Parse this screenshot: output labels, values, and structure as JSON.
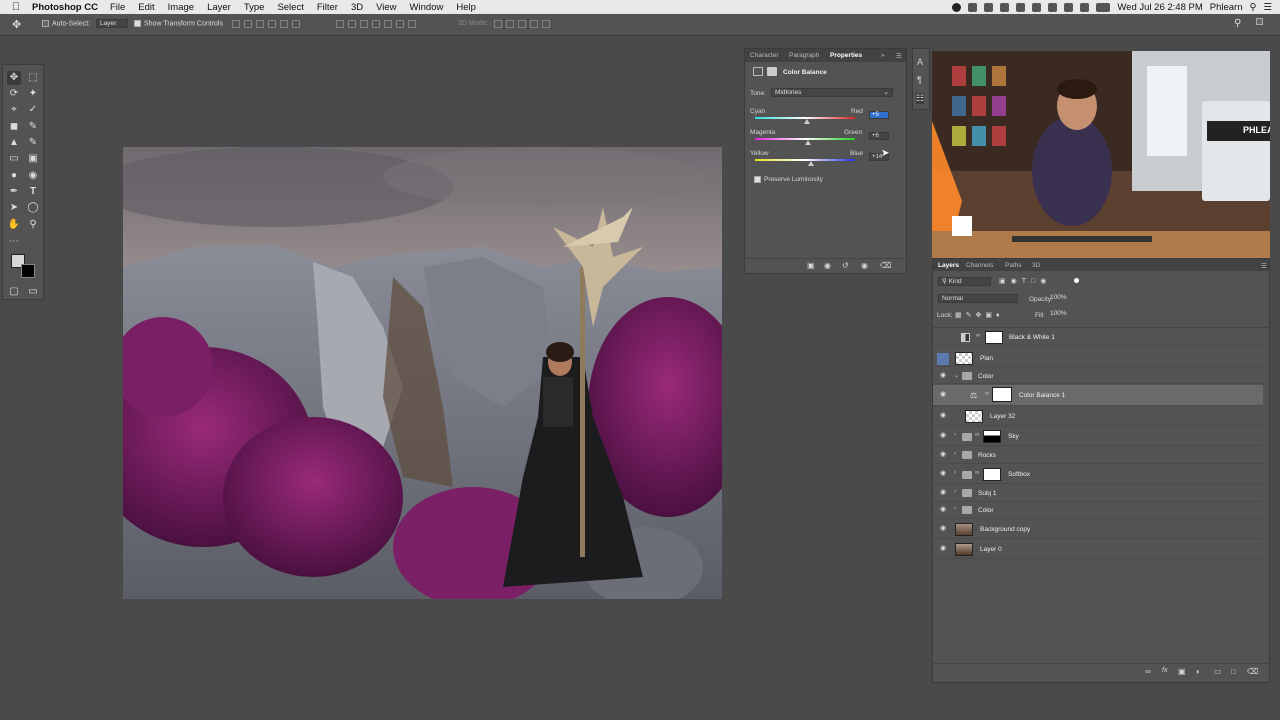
{
  "menubar": {
    "apple": "",
    "app_name": "Photoshop CC",
    "menus": [
      "File",
      "Edit",
      "Image",
      "Layer",
      "Type",
      "Select",
      "Filter",
      "3D",
      "View",
      "Window",
      "Help"
    ],
    "clock": "Wed Jul 26  2:48 PM",
    "user": "Phlearn"
  },
  "options_bar": {
    "auto_select_label": "Auto-Select:",
    "auto_select_value": "Layer",
    "show_transform_label": "Show Transform Controls",
    "mode_3d_label": "3D Mode:"
  },
  "properties_panel": {
    "tabs": [
      "Character",
      "Paragraph",
      "Properties"
    ],
    "active_tab": "Properties",
    "title": "Color Balance",
    "tone_label": "Tone:",
    "tone_value": "Midtones",
    "sliders": [
      {
        "left": "Cyan",
        "right": "Red",
        "value": "+5",
        "position": 0.52
      },
      {
        "left": "Magenta",
        "right": "Green",
        "value": "+6",
        "position": 0.53
      },
      {
        "left": "Yellow",
        "right": "Blue",
        "value": "+14",
        "position": 0.56
      }
    ],
    "preserve_label": "Preserve Luminosity",
    "preserve_checked": true
  },
  "layers_panel": {
    "tabs": [
      "Layers",
      "Channels",
      "Paths",
      "3D"
    ],
    "active_tab": "Layers",
    "filter_label": "Kind",
    "blend_mode": "Normal",
    "opacity_label": "Opacity:",
    "opacity_value": "100%",
    "lock_label": "Lock:",
    "fill_label": "Fill:",
    "fill_value": "100%",
    "layers": [
      {
        "name": "Black & White 1",
        "visible": false,
        "selected": false
      },
      {
        "name": "Plan",
        "visible": false,
        "selected": false
      },
      {
        "name": "Color",
        "visible": true,
        "selected": false
      },
      {
        "name": "Color Balance 1",
        "visible": true,
        "selected": true
      },
      {
        "name": "Layer 32",
        "visible": true,
        "selected": false
      },
      {
        "name": "Sky",
        "visible": true,
        "selected": false
      },
      {
        "name": "Rocks",
        "visible": true,
        "selected": false
      },
      {
        "name": "Softbox",
        "visible": true,
        "selected": false
      },
      {
        "name": "Subj 1",
        "visible": true,
        "selected": false
      },
      {
        "name": "Color",
        "visible": true,
        "selected": false
      },
      {
        "name": "Background copy",
        "visible": true,
        "selected": false
      },
      {
        "name": "Layer 0",
        "visible": true,
        "selected": false
      }
    ]
  },
  "video_overlay": {
    "sign_text": "PHLEA"
  },
  "colors": {
    "panel_bg": "#535353",
    "workspace_bg": "#4a4a4a",
    "selected_row": "#6a6a6a",
    "value_highlight": "#2f6fd0"
  }
}
